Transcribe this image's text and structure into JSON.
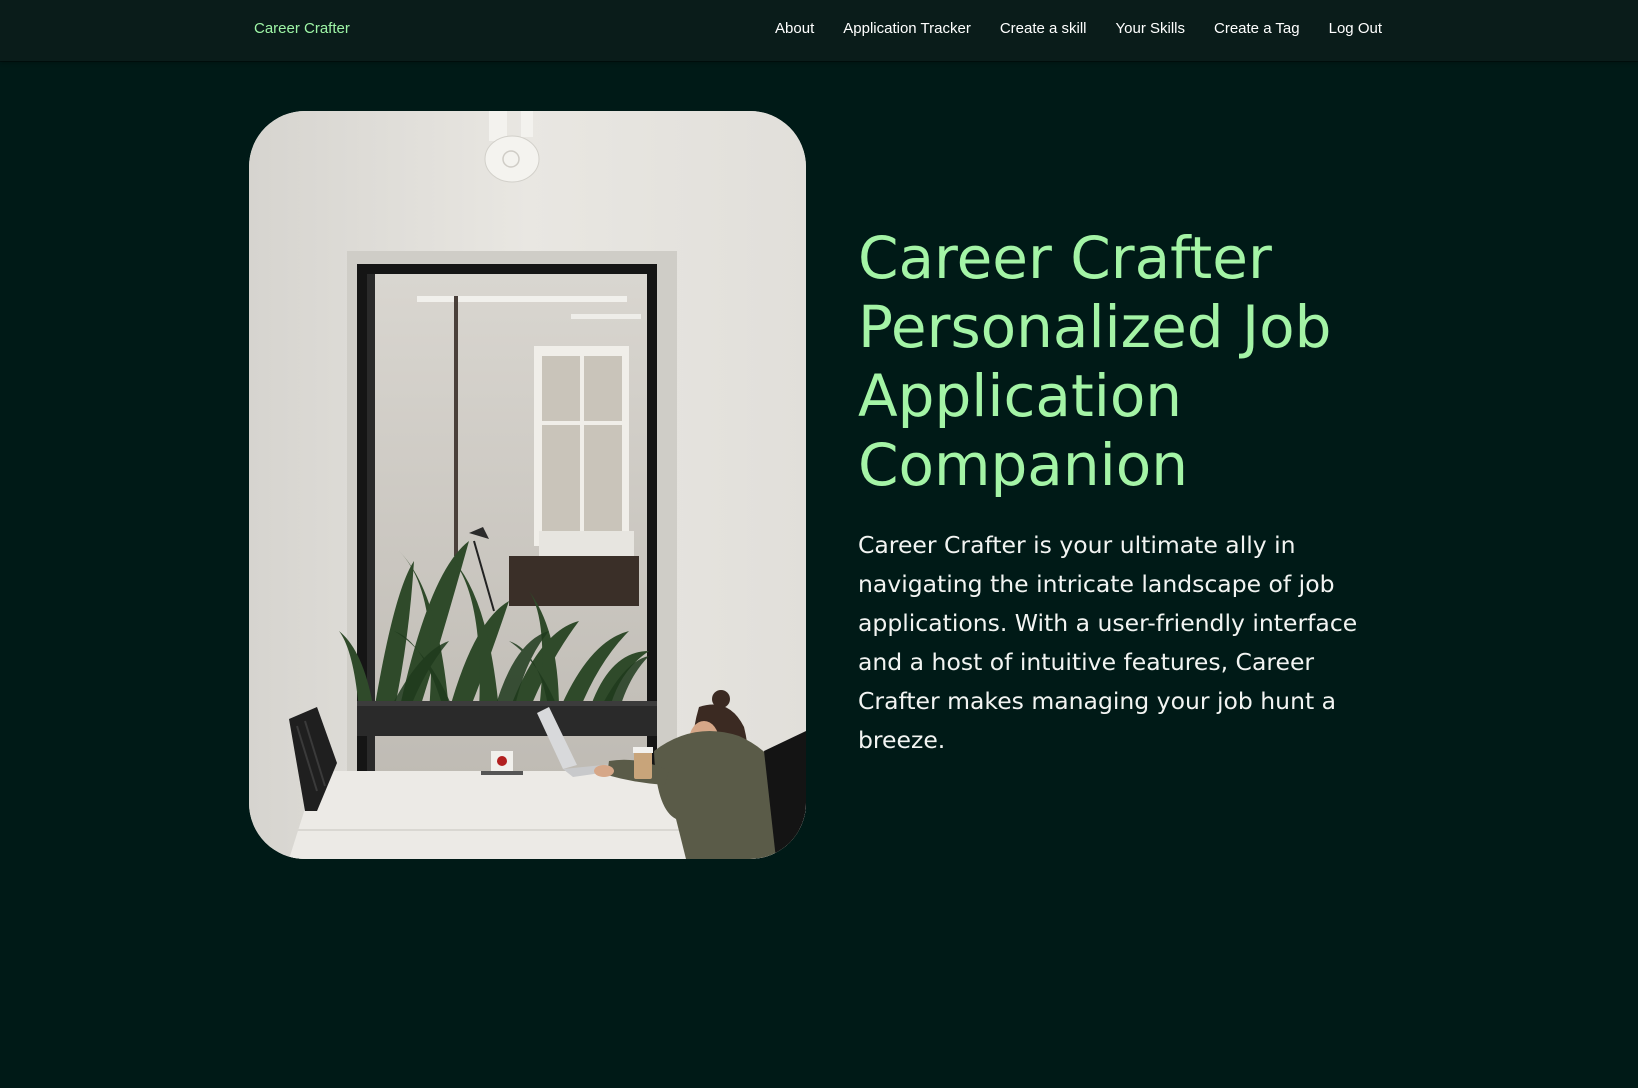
{
  "nav": {
    "brand": "Career Crafter",
    "links": [
      "About",
      "Application Tracker",
      "Create a skill",
      "Your Skills",
      "Create a Tag",
      "Log Out"
    ]
  },
  "hero": {
    "title": "Career Crafter\nPersonalized Job\nApplication\nCompanion",
    "description": "Career Crafter is your ultimate ally in navigating the intricate landscape of job applications. With a user-friendly interface and a host of intuitive features, Career Crafter makes managing your job hunt a breeze.",
    "image_subject": "woman working on laptop at white table in bright office with plants"
  },
  "colors": {
    "page_background": "#001a17",
    "navbar_background": "#0a1c1a",
    "accent_green": "#a4f4a6",
    "text_white": "#ffffff"
  }
}
